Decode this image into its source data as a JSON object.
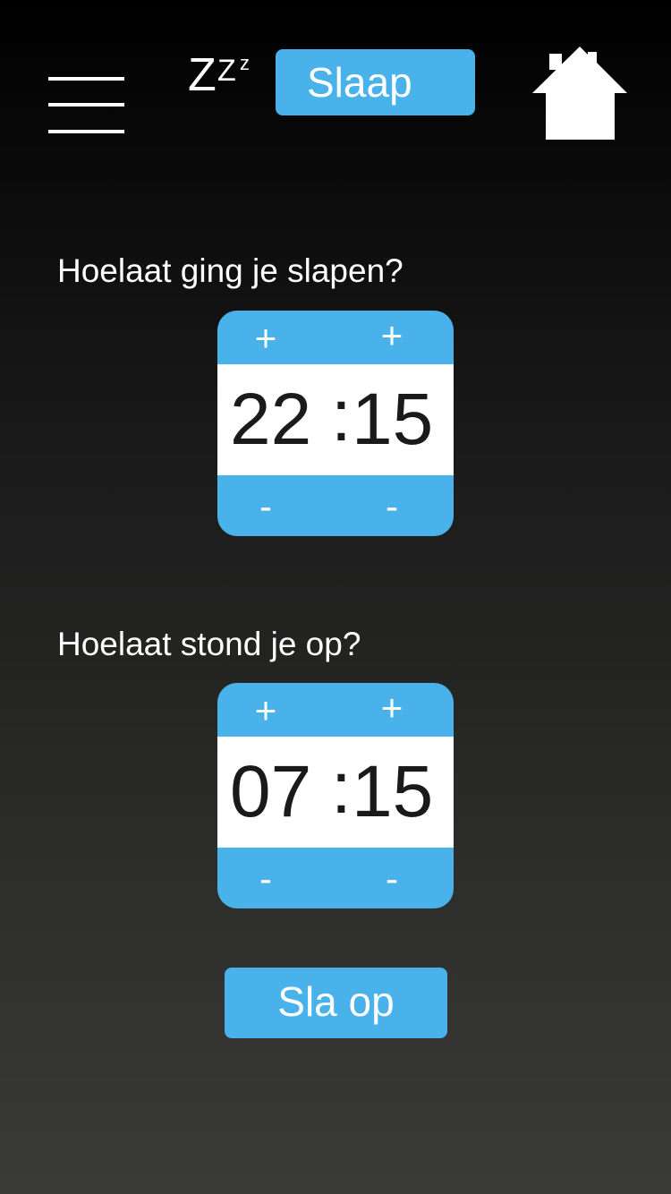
{
  "header": {
    "menu_icon": "hamburger-menu-icon",
    "sleep_icon_letters": [
      "Z",
      "Z",
      "z"
    ],
    "title": "Slaap",
    "home_icon": "home-icon",
    "accent_color": "#4ab2eb"
  },
  "bedtime": {
    "question": "Hoelaat ging je slapen?",
    "hours": "22",
    "separator": ":",
    "minutes": "15",
    "increment_label": "+",
    "decrement_label": "-"
  },
  "wake_time": {
    "question": "Hoelaat stond je op?",
    "hours": "07",
    "separator": ":",
    "minutes": "15",
    "increment_label": "+",
    "decrement_label": "-"
  },
  "save_button": {
    "label": "Sla op"
  }
}
